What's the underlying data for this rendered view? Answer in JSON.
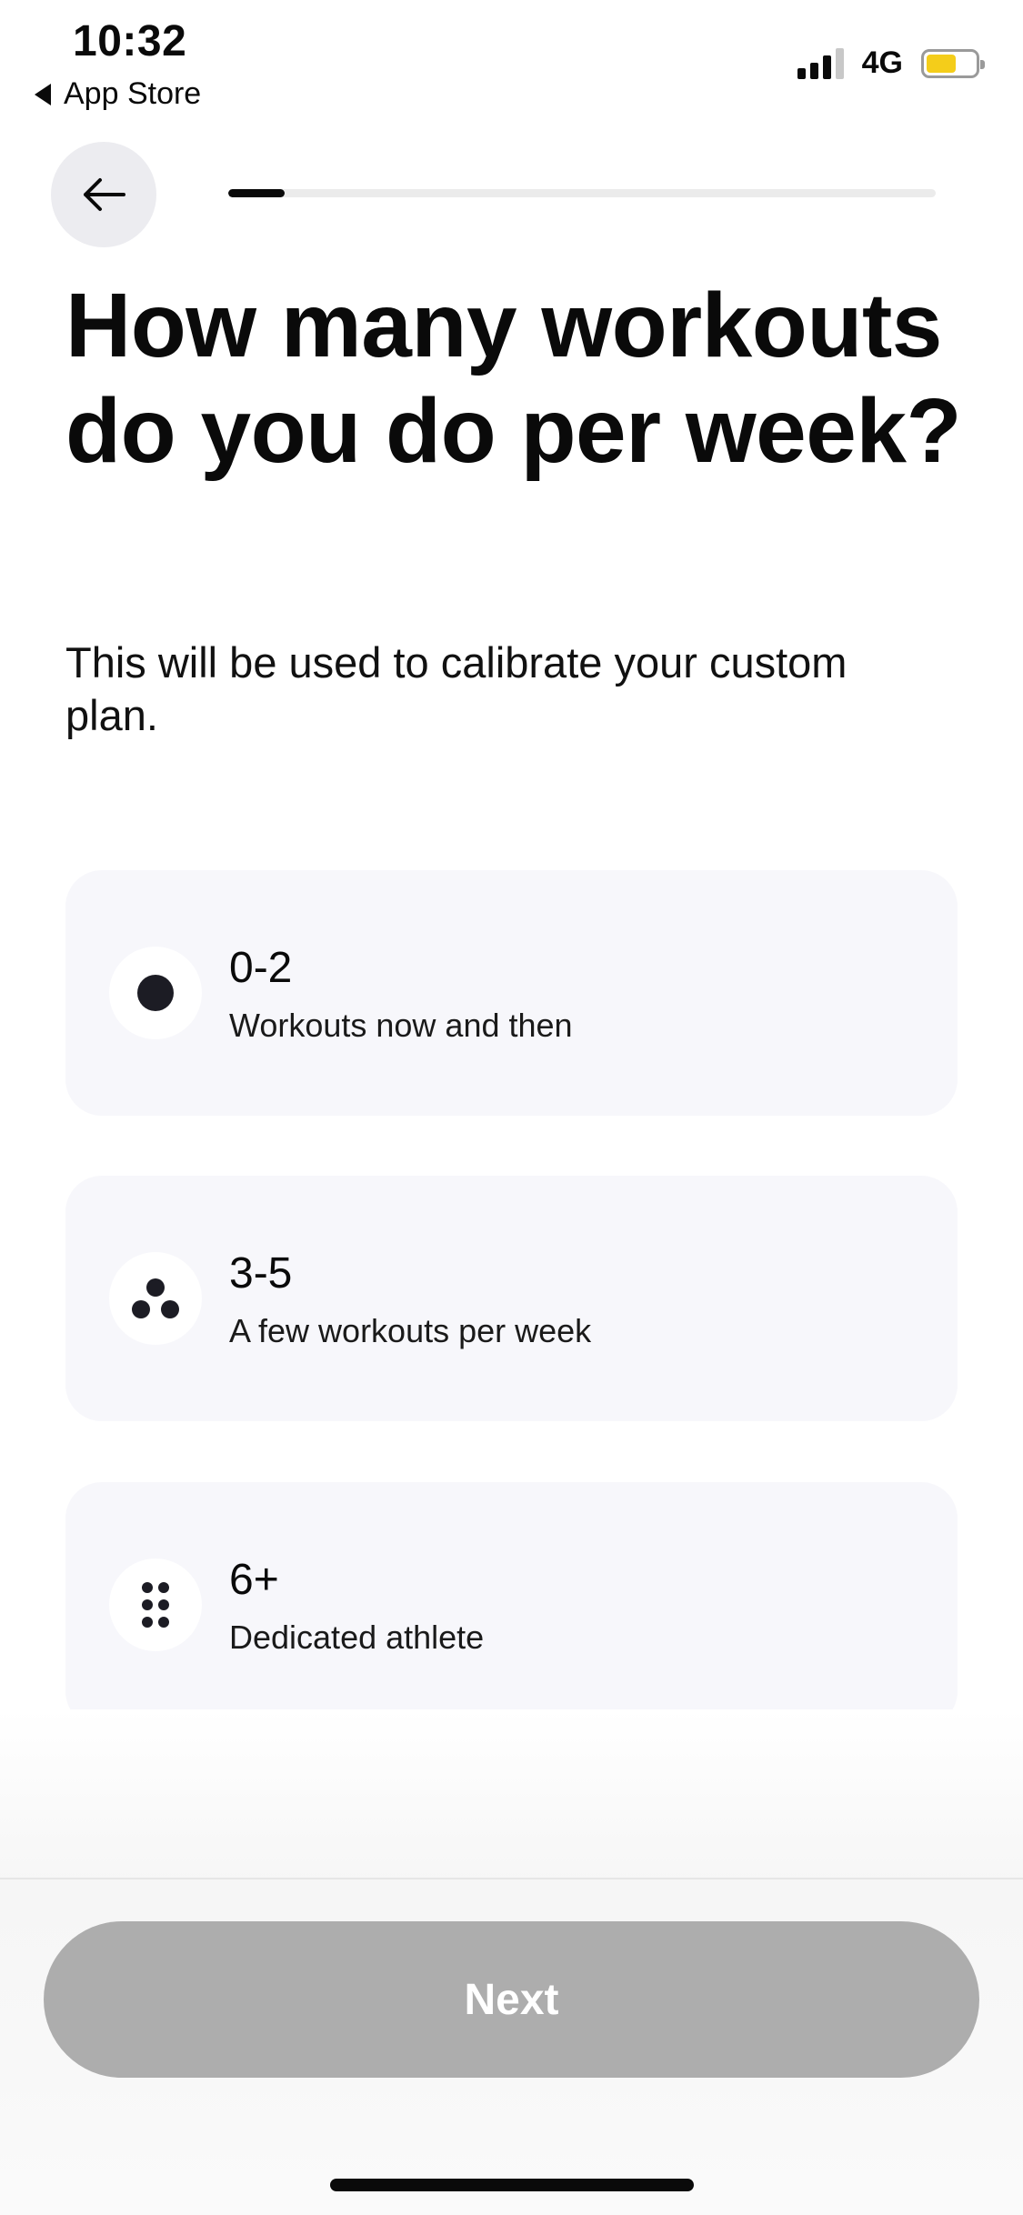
{
  "status_bar": {
    "time": "10:32",
    "back_app": "App Store",
    "network": "4G",
    "battery_level_fraction": 0.62
  },
  "progress": {
    "fraction": 0.08
  },
  "heading": {
    "title": "How many workouts do you do per week?",
    "subtitle": "This will be used to calibrate your custom plan."
  },
  "options": [
    {
      "label": "0-2",
      "description": "Workouts now and then",
      "icon": "single-dot-icon"
    },
    {
      "label": "3-5",
      "description": "A few workouts per week",
      "icon": "three-dots-icon"
    },
    {
      "label": "6+",
      "description": "Dedicated athlete",
      "icon": "six-dots-icon"
    }
  ],
  "footer": {
    "next_label": "Next"
  },
  "colors": {
    "accent": "#0a0a0a",
    "card_background": "#f7f7fb",
    "disabled_button": "#adadad",
    "battery": "#f4cd1a"
  }
}
